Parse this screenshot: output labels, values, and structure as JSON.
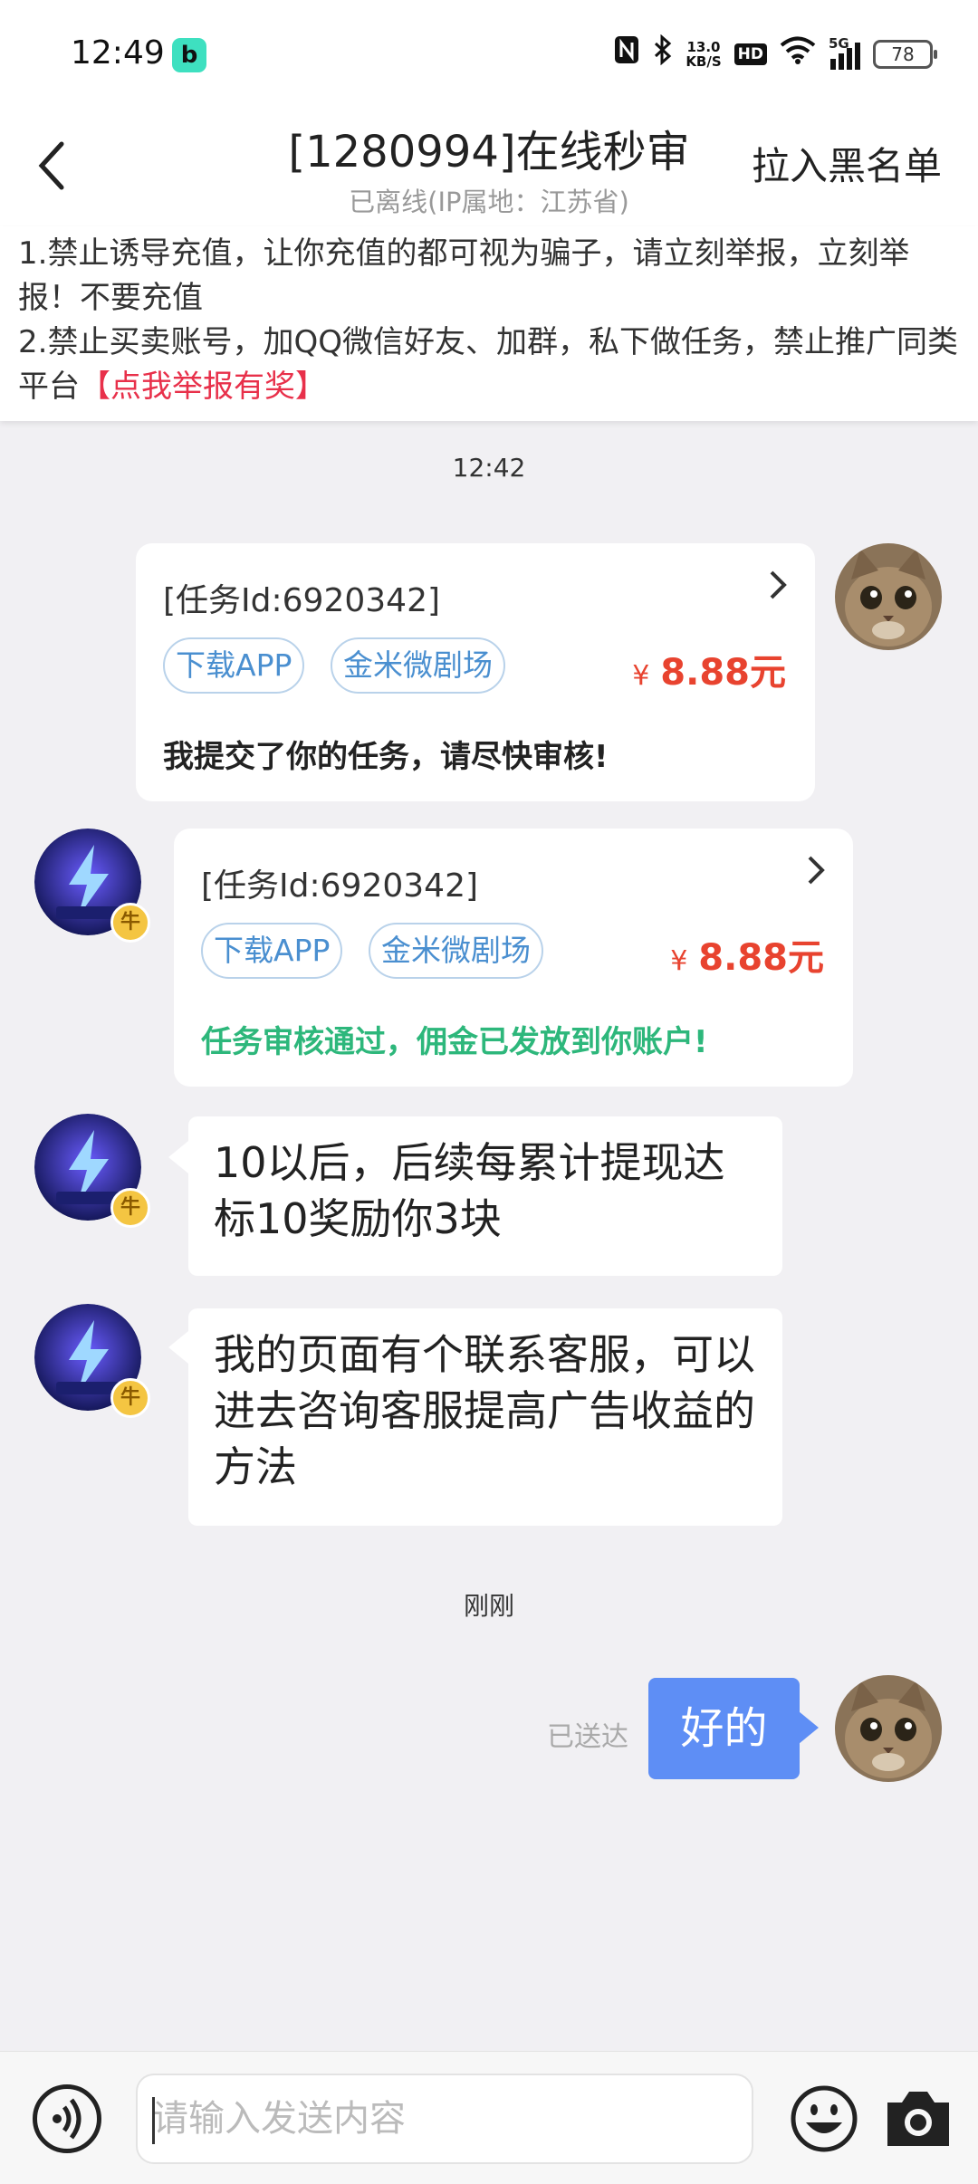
{
  "status_bar": {
    "time": "12:49",
    "app_icon_letter": "b",
    "net_speed_value": "13.0",
    "net_speed_unit": "KB/S",
    "hd_label": "HD",
    "network_type": "5G",
    "battery": "78"
  },
  "header": {
    "title": "[1280994]在线秒审",
    "subtitle": "已离线(IP属地：江苏省)",
    "blacklist_label": "拉入黑名单"
  },
  "notice": {
    "line1": "1.禁止诱导充值，让你充值的都可视为骗子，请立刻举报，立刻举报！不要充值",
    "line2": "2.禁止买卖账号，加QQ微信好友、加群，私下做任务，禁止推广同类平台",
    "report_link": "【点我举报有奖】"
  },
  "chat": {
    "timestamp1": "12:42",
    "card_sent": {
      "task_id": "[任务Id:6920342]",
      "tag1": "下载APP",
      "tag2": "金米微剧场",
      "currency": "¥",
      "price": "8.88元",
      "message": "我提交了你的任务，请尽快审核!",
      "message_color": "#222222"
    },
    "card_received": {
      "task_id": "[任务Id:6920342]",
      "tag1": "下载APP",
      "tag2": "金米微剧场",
      "currency": "¥",
      "price": "8.88元",
      "message": "任务审核通过，佣金已发放到你账户!",
      "message_color": "#2db77b"
    },
    "msg1": "10以后，后续每累计提现达标10奖励你3块",
    "msg2": "我的页面有个联系客服，可以进去咨询客服提高广告收益的方法",
    "timestamp2": "刚刚",
    "reply": "好的",
    "delivered": "已送达",
    "badge_glyph": "牛"
  },
  "input": {
    "placeholder": "请输入发送内容"
  },
  "colors": {
    "accent_blue": "#5e8ef5",
    "price_red": "#e8432f",
    "link_red": "#e8304a",
    "approved_green": "#2db77b",
    "tag_blue": "#4a8fd0"
  }
}
